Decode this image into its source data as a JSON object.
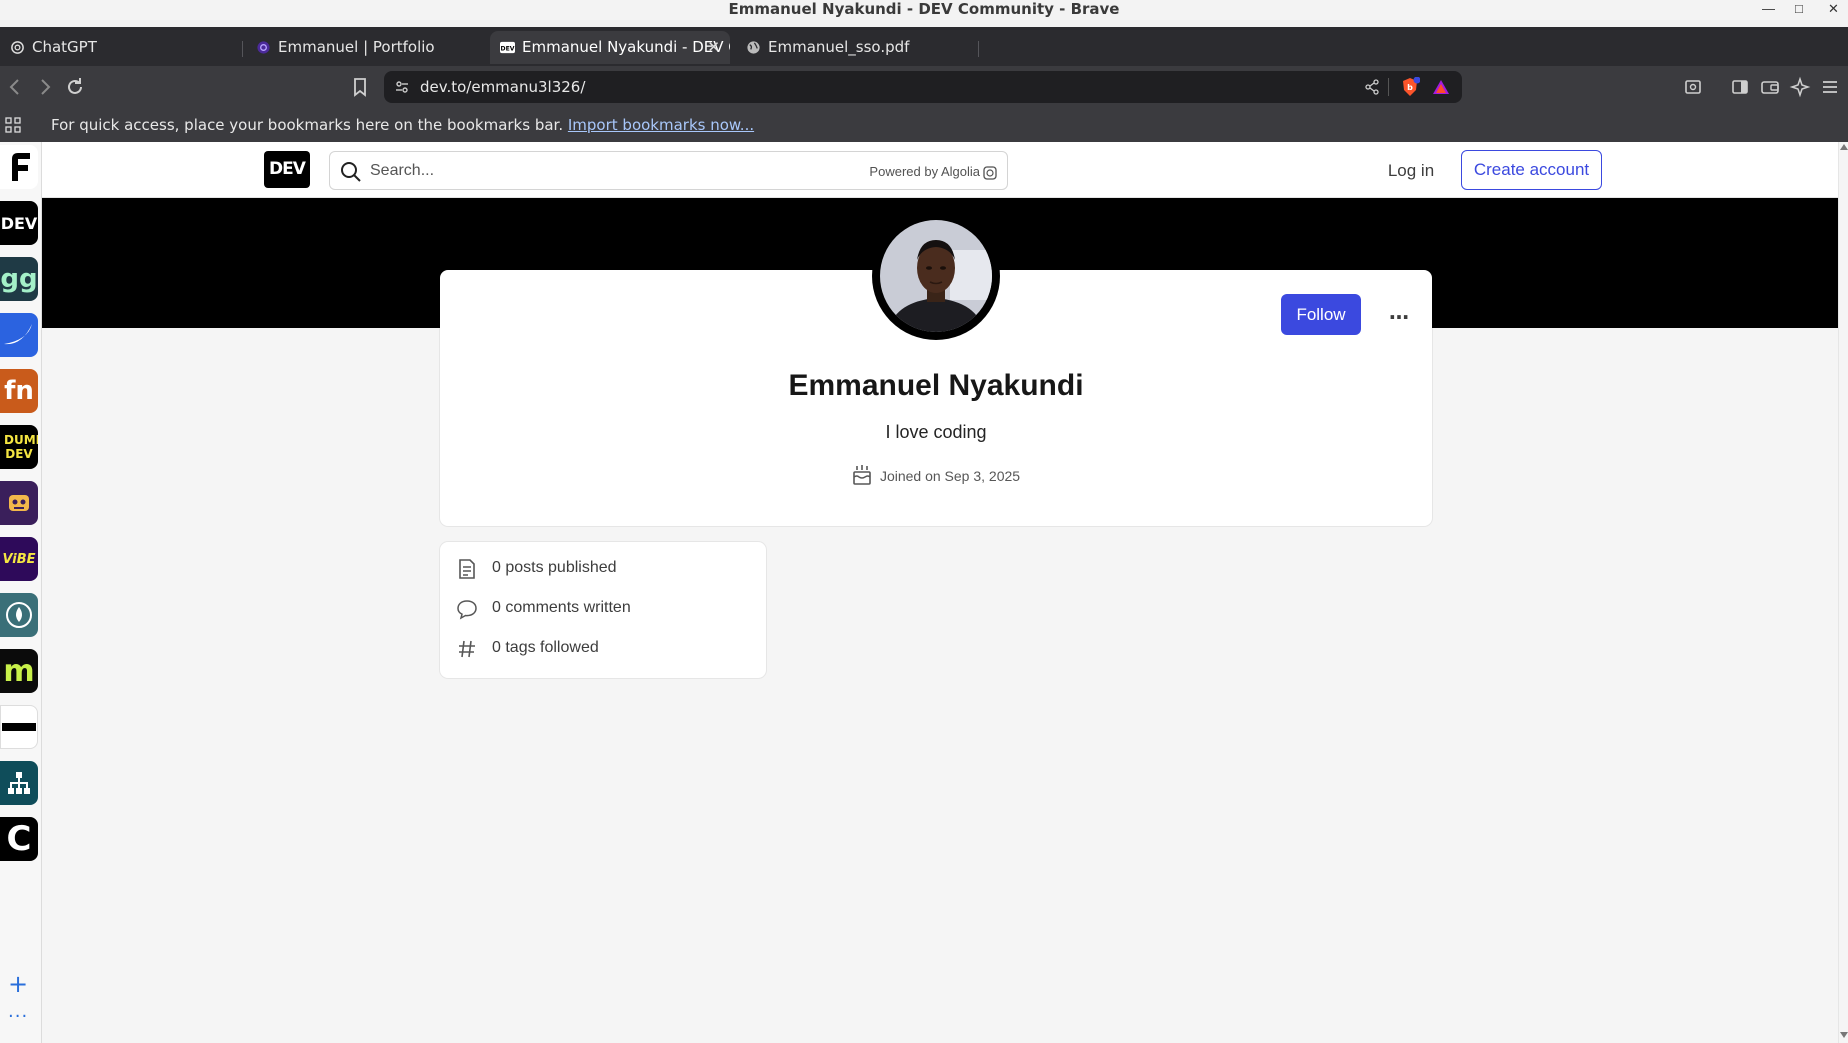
{
  "window": {
    "title": "Emmanuel Nyakundi - DEV Community - Brave"
  },
  "tabs": [
    {
      "label": "ChatGPT",
      "icon": "chatgpt-icon"
    },
    {
      "label": "Emmanuel | Portfolio",
      "icon": "portfolio-icon"
    },
    {
      "label": "Emmanuel Nyakundi - DEV Community",
      "icon": "dev-icon",
      "active": true
    },
    {
      "label": "Emmanuel_sso.pdf",
      "icon": "globe-icon"
    }
  ],
  "toolbar": {
    "url": "dev.to/emmanu3l326/"
  },
  "bookmarks_bar": {
    "text": "For quick access, place your bookmarks here on the bookmarks bar.",
    "link": "Import bookmarks now..."
  },
  "sidebar": {
    "items": [
      {
        "name": "forem",
        "label": "F",
        "color": "#000000"
      },
      {
        "name": "dev",
        "label": "DEV",
        "color": "#000000"
      },
      {
        "name": "gg",
        "label": "gg",
        "color": "#1f3a45"
      },
      {
        "name": "swoosh",
        "label": "",
        "color": "#2b63e0"
      },
      {
        "name": "fm",
        "label": "fn",
        "color": "#c95b1b"
      },
      {
        "name": "dumb-dev",
        "label": "DUMB DEV",
        "color": "#000000"
      },
      {
        "name": "robot",
        "label": "",
        "color": "#3a1f5b"
      },
      {
        "name": "vibe",
        "label": "ViBE",
        "color": "#2e0a5a"
      },
      {
        "name": "drop",
        "label": "",
        "color": "#3a6f78"
      },
      {
        "name": "m",
        "label": "m",
        "color": "#0b0b0b"
      },
      {
        "name": "bar",
        "label": "",
        "color": "#ffffff"
      },
      {
        "name": "tree",
        "label": "",
        "color": "#0f4d5a"
      },
      {
        "name": "c",
        "label": "C",
        "color": "#000000"
      }
    ]
  },
  "header": {
    "logo": "DEV",
    "search_placeholder": "Search...",
    "powered_by": "Powered by Algolia",
    "login": "Log in",
    "create_account": "Create account"
  },
  "profile": {
    "name": "Emmanuel Nyakundi",
    "bio": "I love coding",
    "joined": "Joined on Sep 3, 2025",
    "follow": "Follow",
    "more": "…"
  },
  "stats": [
    {
      "icon": "post-icon",
      "label": "0 posts published"
    },
    {
      "icon": "comment-icon",
      "label": "0 comments written"
    },
    {
      "icon": "hash-icon",
      "label": "0 tags followed"
    }
  ],
  "colors": {
    "accent": "#3b49df",
    "banner": "#000000"
  }
}
